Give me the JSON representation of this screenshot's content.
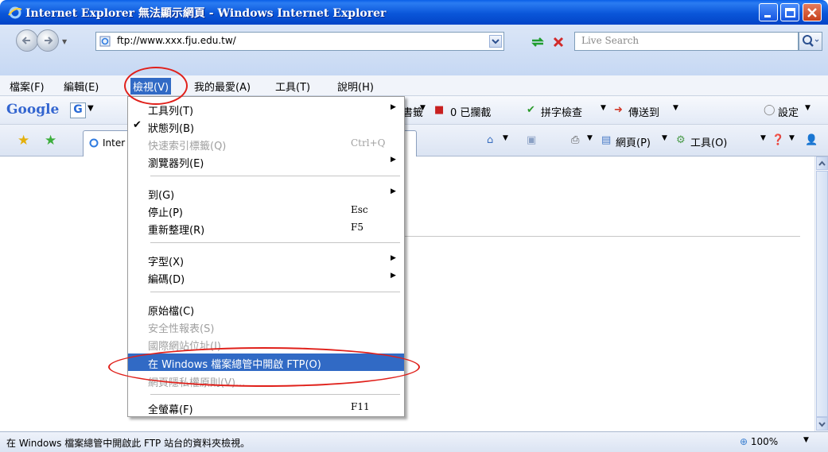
{
  "window": {
    "title": "Internet Explorer 無法顯示網頁 - Windows Internet Explorer"
  },
  "address": {
    "url": "ftp://www.xxx.fju.edu.tw/",
    "search_placeholder": "Live Search"
  },
  "menubar": {
    "items": [
      "檔案(F)",
      "編輯(E)",
      "檢視(V)",
      "我的最愛(A)",
      "工具(T)",
      "說明(H)"
    ]
  },
  "google_toolbar": {
    "logo": "Google",
    "box": "G",
    "bookmarks": "書籤",
    "blocked": "0 已攔截",
    "spellcheck": "拼字檢查",
    "send_to": "傳送到",
    "settings": "設定"
  },
  "tab": {
    "title": "Inter"
  },
  "command_bar": {
    "page": "網頁(P)",
    "tools": "工具(O)"
  },
  "view_menu": {
    "items": [
      {
        "label": "工具列(T)",
        "shortcut": "",
        "submenu": true,
        "checked": false,
        "disabled": false
      },
      {
        "label": "狀態列(B)",
        "shortcut": "",
        "submenu": false,
        "checked": true,
        "disabled": false
      },
      {
        "label": "快速索引標籤(Q)",
        "shortcut": "Ctrl+Q",
        "submenu": false,
        "checked": false,
        "disabled": true
      },
      {
        "label": "瀏覽器列(E)",
        "shortcut": "",
        "submenu": true,
        "checked": false,
        "disabled": false
      },
      {
        "label": "到(G)",
        "shortcut": "",
        "submenu": true,
        "checked": false,
        "disabled": false
      },
      {
        "label": "停止(P)",
        "shortcut": "Esc",
        "submenu": false,
        "checked": false,
        "disabled": false
      },
      {
        "label": "重新整理(R)",
        "shortcut": "F5",
        "submenu": false,
        "checked": false,
        "disabled": false
      },
      {
        "label": "字型(X)",
        "shortcut": "",
        "submenu": true,
        "checked": false,
        "disabled": false
      },
      {
        "label": "編碼(D)",
        "shortcut": "",
        "submenu": true,
        "checked": false,
        "disabled": false
      },
      {
        "label": "原始檔(C)",
        "shortcut": "",
        "submenu": false,
        "checked": false,
        "disabled": false
      },
      {
        "label": "安全性報表(S)",
        "shortcut": "",
        "submenu": false,
        "checked": false,
        "disabled": true
      },
      {
        "label": "國際網站位址(I)",
        "shortcut": "",
        "submenu": false,
        "checked": false,
        "disabled": true
      },
      {
        "label": "在 Windows 檔案總管中開啟 FTP(O)",
        "shortcut": "",
        "submenu": false,
        "checked": false,
        "disabled": false,
        "highlighted": true
      },
      {
        "label": "網頁隱私權原則(V)...",
        "shortcut": "",
        "submenu": false,
        "checked": false,
        "disabled": true
      },
      {
        "label": "全螢幕(F)",
        "shortcut": "F11",
        "submenu": false,
        "checked": false,
        "disabled": false
      }
    ]
  },
  "status": {
    "text": "在 Windows 檔案總管中開啟此 FTP 站台的資料夾檢視。",
    "zoom": "100%"
  },
  "colors": {
    "highlight": "#316ac5",
    "annotation": "#e0201a",
    "titlebar": "#0a56d9"
  }
}
